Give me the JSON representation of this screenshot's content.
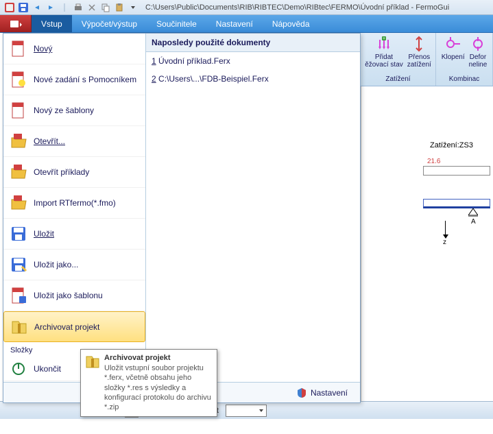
{
  "title_path": "C:\\Users\\Public\\Documents\\RIB\\RIBTEC\\Demo\\RIBtec\\FERMO\\Úvodní příklad - FermoGui",
  "menubar": {
    "items": [
      "Vstup",
      "Výpočet/výstup",
      "Součinitele",
      "Nastavení",
      "Nápověda"
    ],
    "active_index": 0
  },
  "file_menu": {
    "items": [
      {
        "label": "Nový",
        "underline": true,
        "icon": "doc-red"
      },
      {
        "label": "Nové zadání s Pomocníkem",
        "icon": "doc-red"
      },
      {
        "label": "Nový ze šablony",
        "icon": "doc-red"
      },
      {
        "label": "Otevřít...",
        "underline": true,
        "icon": "folder-open"
      },
      {
        "label": "Otevřít příklady",
        "icon": "folder-open"
      },
      {
        "label": "Import RTfermo(*.fmo)",
        "icon": "folder-open"
      },
      {
        "label": "Uložit",
        "underline": true,
        "icon": "save"
      },
      {
        "label": "Uložit jako...",
        "icon": "save"
      },
      {
        "label": "Uložit jako šablonu",
        "icon": "doc-red"
      },
      {
        "label": "Archivovat projekt",
        "icon": "archive",
        "hover": true
      }
    ],
    "section_label": "Složky",
    "exit_label": "Ukončit"
  },
  "recent": {
    "header": "Naposledy použité dokumenty",
    "items": [
      {
        "n": "1",
        "label": "Úvodní příklad.Ferx"
      },
      {
        "n": "2",
        "label": "C:\\Users\\...\\FDB-Beispiel.Ferx"
      }
    ]
  },
  "footer": {
    "settings": "Nastavení"
  },
  "tooltip": {
    "title": "Archivovat projekt",
    "body": "Uložit vstupní soubor projektu *.ferx, včetně obsahu jeho složky *.res s výsledky a konfigurací protokolu do archivu *.zip"
  },
  "ribbon": {
    "group1": {
      "btn1": "Přidat\něžovací stav",
      "btn2": "Přenos\nzatížení",
      "label": "Zatížení"
    },
    "group2": {
      "btn1": "Klopení",
      "btn2": "Defor\nneline",
      "label": "Kombinac"
    }
  },
  "canvas": {
    "load_label": "Zatížení:ZS3",
    "dim": "21.6",
    "support": "A",
    "axis": "z"
  },
  "statusbar": {
    "transparency": "Průhlednost"
  }
}
